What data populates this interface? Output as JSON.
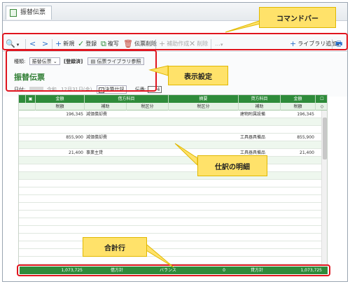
{
  "window": {
    "tab_title": "振替伝票"
  },
  "callouts": {
    "command_bar": "コマンドバー",
    "display_settings": "表示設定",
    "journal_details": "仕訳の明細",
    "total_row": "合計行"
  },
  "toolbar": {
    "search": "🔍",
    "back": "<",
    "forward": ">",
    "new": "新規",
    "register": "登録",
    "copy": "複写",
    "delete_voucher": "伝票削除",
    "add_auxiliary": "補助作成",
    "delete": "削除",
    "more": "…",
    "library_add": "ライブラリ追加",
    "print": "🖶"
  },
  "settings": {
    "type_label": "種類:",
    "type_value": "振替伝票",
    "mode_label": "[登録済]",
    "library_button": "伝票ライブラリ参照",
    "voucher_title": "振替伝票",
    "date_label": "日付:",
    "date_era": "令和",
    "date_value": "12月31日(金)",
    "closing_label": "決算仕訳",
    "voucher_no_label": "伝番:",
    "voucher_no_value": "4"
  },
  "grid": {
    "header_top": [
      "金額",
      "借方科目",
      "摘要",
      "貸方科目",
      "金額"
    ],
    "header_bottom": [
      "税額",
      "補助",
      "税区分",
      "税区分",
      "補助",
      "税額"
    ],
    "rows": [
      {
        "debit_amount": "196,345",
        "debit_account": "減価償却費",
        "credit_account": "建物附属設備",
        "credit_amount": "196,345"
      },
      {
        "debit_amount": "855,900",
        "debit_account": "減価償却費",
        "credit_account": "工具器具備品",
        "credit_amount": "855,900"
      },
      {
        "debit_amount": "21,400",
        "debit_account": "事業主貸",
        "credit_account": "工具器具備品",
        "credit_amount": "21,400"
      }
    ]
  },
  "footer": {
    "debit_total": "1,073,725",
    "debit_total_label": "借方計",
    "balance_label": "バランス",
    "balance_value": "0",
    "credit_total_label": "貸方計",
    "credit_total": "1,073,725"
  },
  "colors": {
    "accent_green": "#2e8b3a",
    "highlight_red": "#e0141e",
    "callout_yellow": "#ffe26a"
  }
}
